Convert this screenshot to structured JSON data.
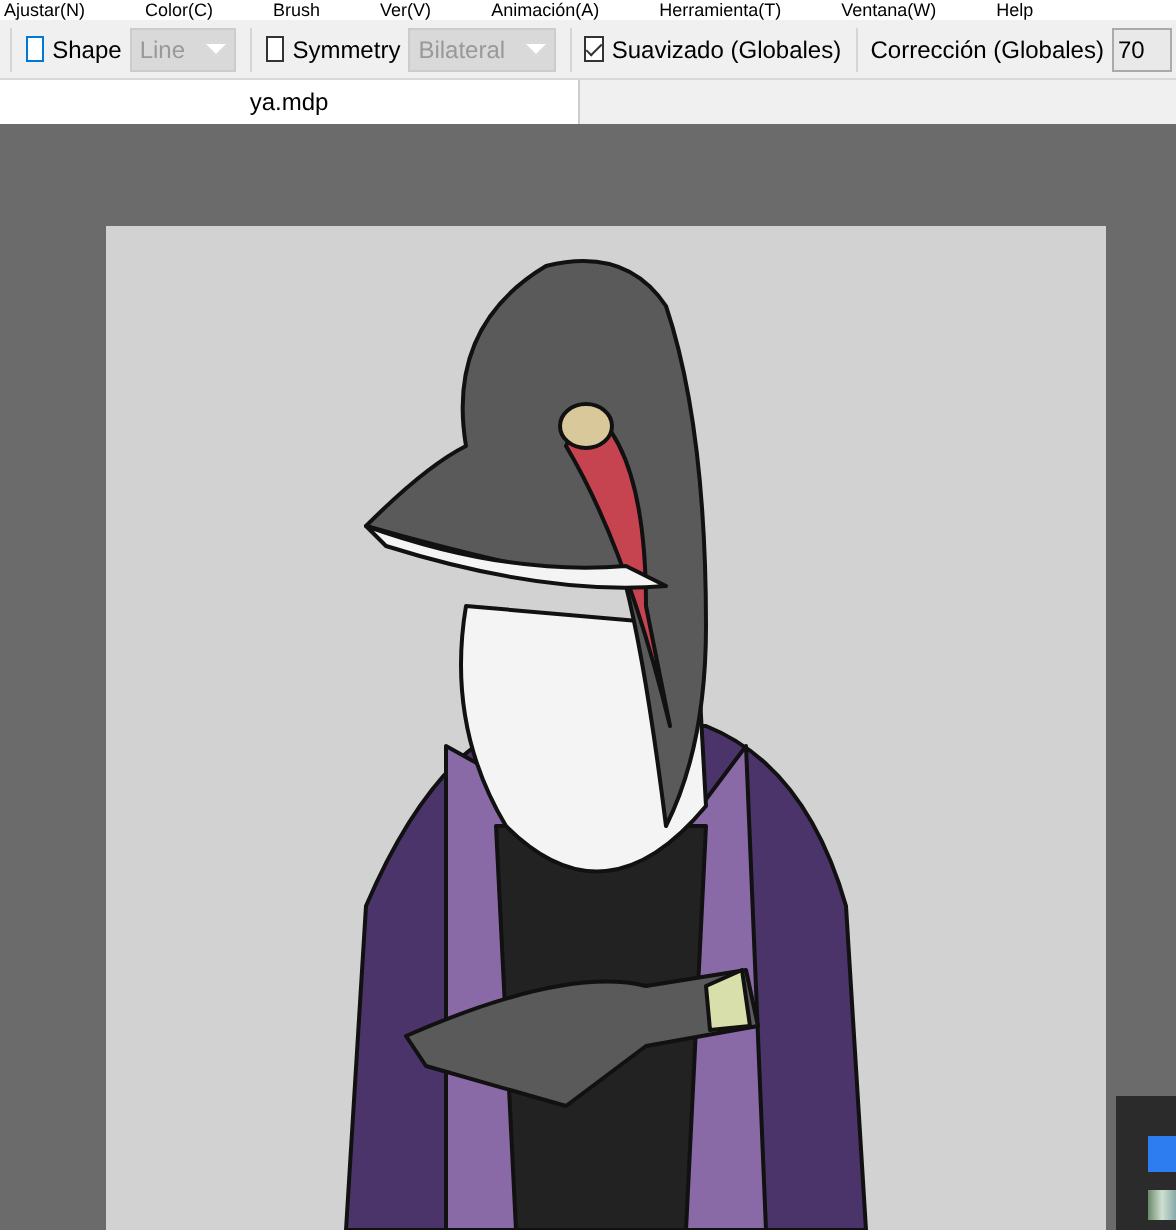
{
  "menu": [
    {
      "label": "Ajustar(N)"
    },
    {
      "label": "Color(C)"
    },
    {
      "label": "Brush"
    },
    {
      "label": "Ver(V)"
    },
    {
      "label": "Animación(A)"
    },
    {
      "label": "Herramienta(T)"
    },
    {
      "label": "Ventana(W)"
    },
    {
      "label": "Help"
    }
  ],
  "toolbar": {
    "shape": {
      "label": "Shape",
      "checked": false,
      "value": "Line",
      "disabled": true
    },
    "symmetry": {
      "label": "Symmetry",
      "checked": false,
      "value": "Bilateral",
      "disabled": true
    },
    "antialias": {
      "label": "Suavizado (Globales)",
      "checked": true
    },
    "correction": {
      "label": "Corrección (Globales)",
      "value": "70"
    }
  },
  "tabs": [
    {
      "label": "ya.mdp",
      "selected": true
    }
  ]
}
